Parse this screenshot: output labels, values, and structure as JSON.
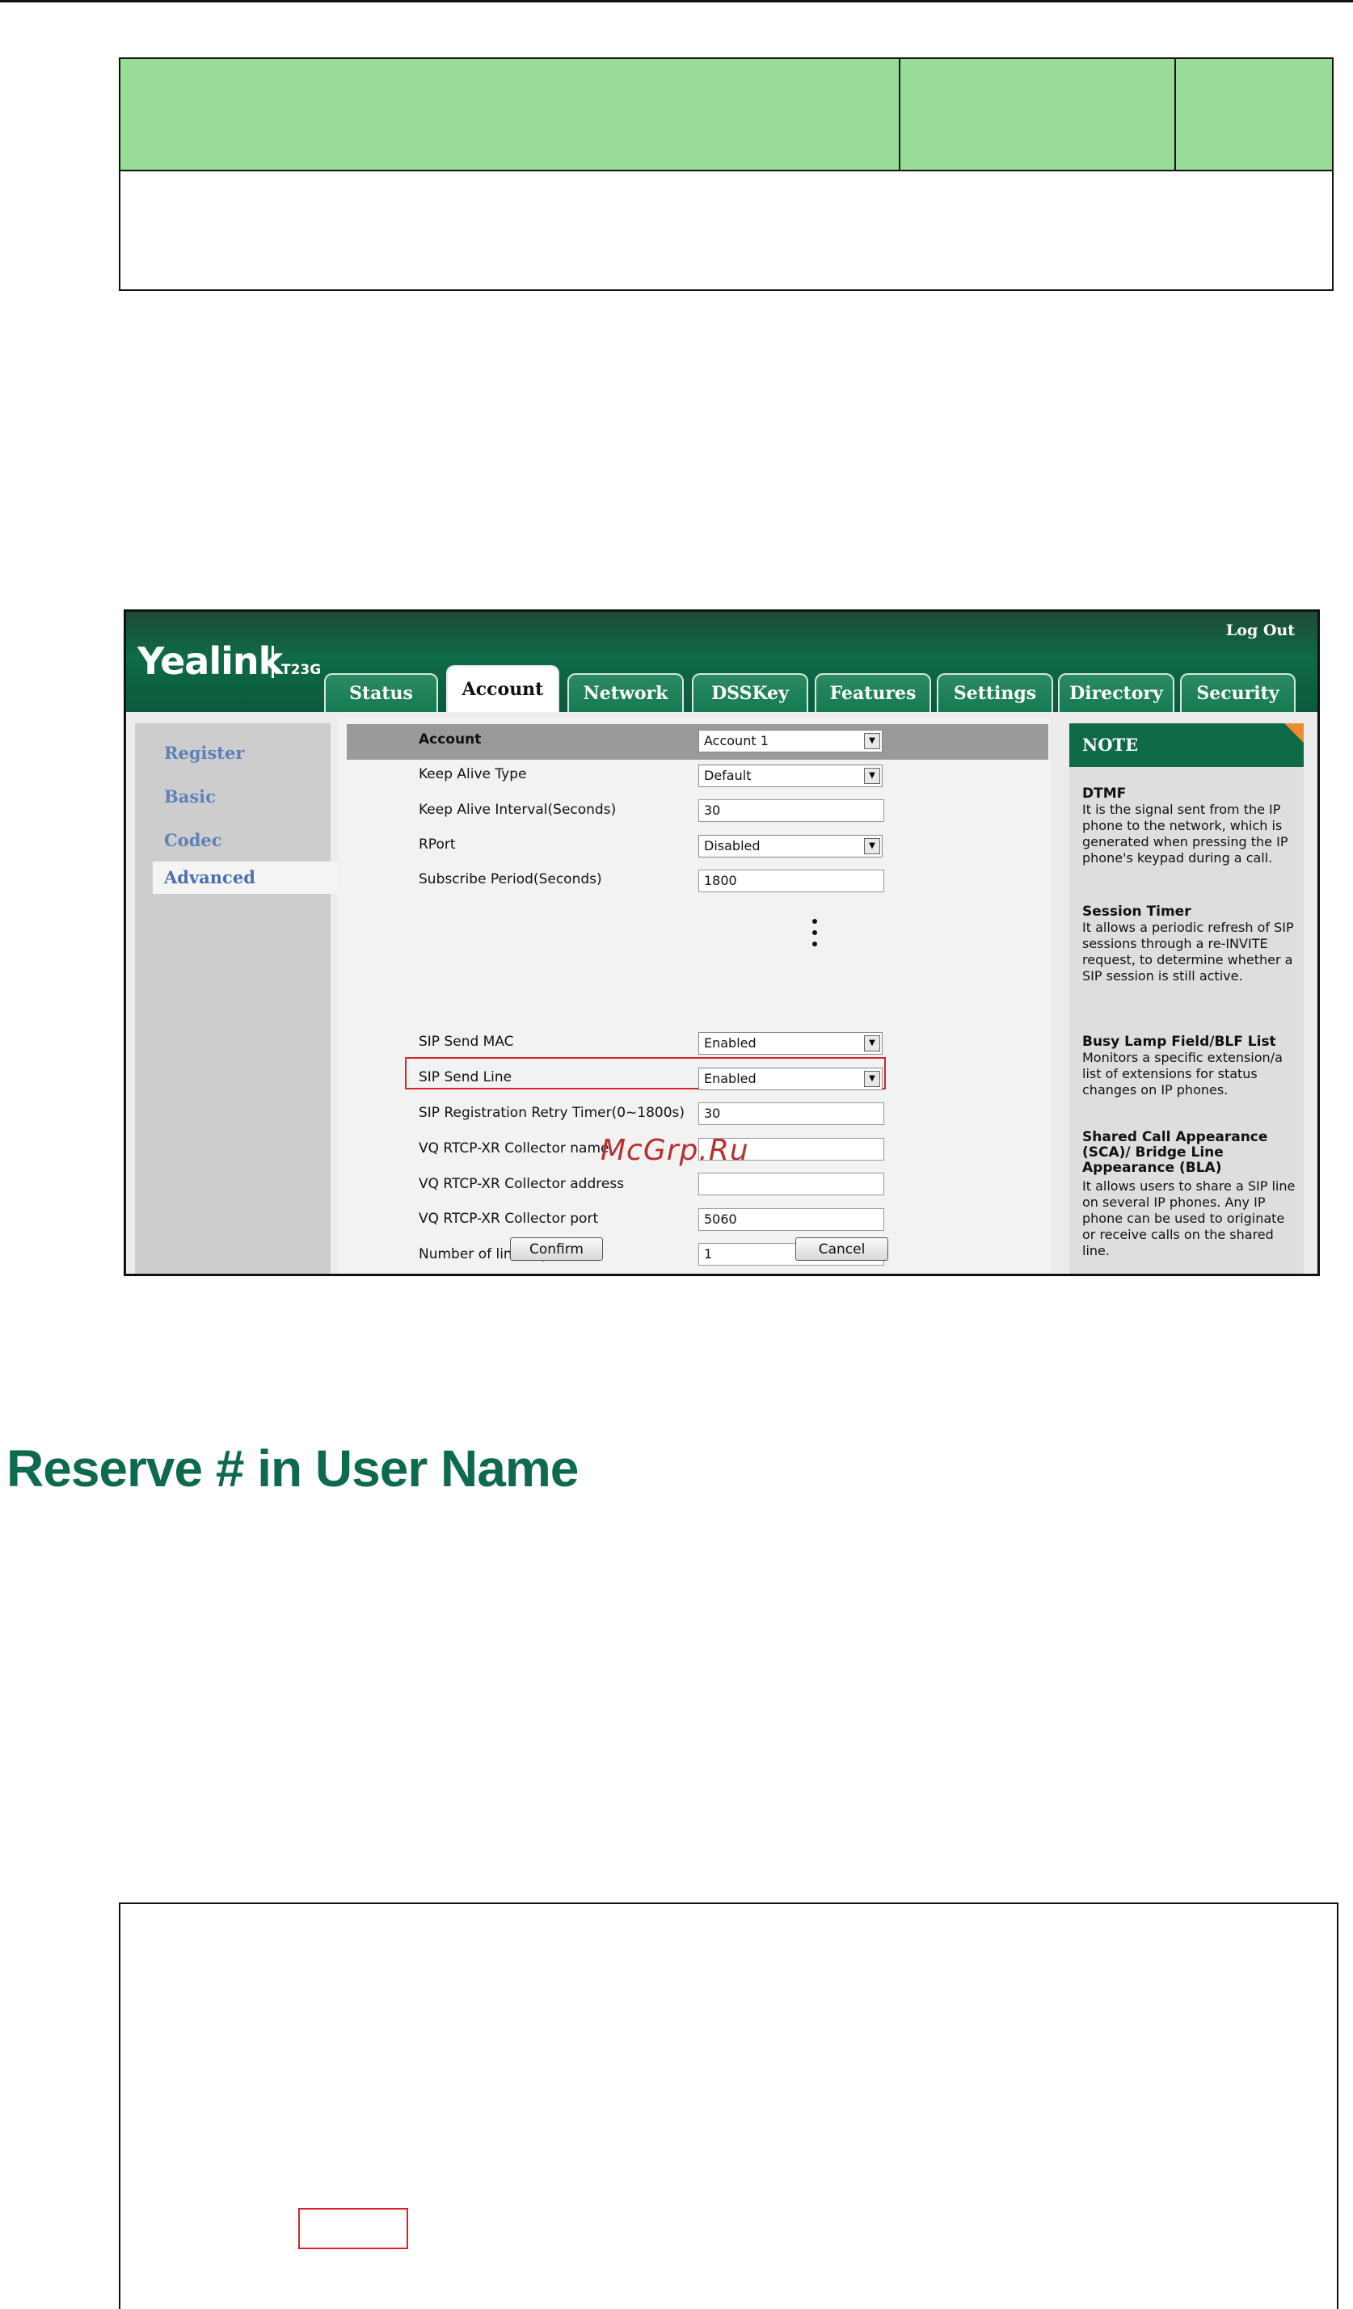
{
  "header": {
    "logo": "Yealink",
    "model": "T23G",
    "logout": "Log Out"
  },
  "tabs": [
    {
      "label": "Status"
    },
    {
      "label": "Account",
      "active": true
    },
    {
      "label": "Network"
    },
    {
      "label": "DSSKey"
    },
    {
      "label": "Features"
    },
    {
      "label": "Settings"
    },
    {
      "label": "Directory"
    },
    {
      "label": "Security"
    }
  ],
  "sidebar": {
    "items": [
      {
        "label": "Register"
      },
      {
        "label": "Basic"
      },
      {
        "label": "Codec"
      },
      {
        "label": "Advanced",
        "active": true
      }
    ]
  },
  "form": {
    "account": {
      "label": "Account",
      "value": "Account 1"
    },
    "keep_alive_type": {
      "label": "Keep Alive Type",
      "value": "Default"
    },
    "keep_alive_interval": {
      "label": "Keep Alive Interval(Seconds)",
      "value": "30"
    },
    "rport": {
      "label": "RPort",
      "value": "Disabled"
    },
    "subscribe_period": {
      "label": "Subscribe Period(Seconds)",
      "value": "1800"
    },
    "sip_send_mac": {
      "label": "SIP Send MAC",
      "value": "Enabled"
    },
    "sip_send_line": {
      "label": "SIP Send Line",
      "value": "Enabled"
    },
    "sip_retry_timer": {
      "label": "SIP Registration Retry Timer(0~1800s)",
      "value": "30"
    },
    "vq_collector_name": {
      "label": "VQ RTCP-XR Collector name",
      "value": ""
    },
    "vq_collector_address": {
      "label": "VQ RTCP-XR Collector address",
      "value": ""
    },
    "vq_collector_port": {
      "label": "VQ RTCP-XR Collector port",
      "value": "5060"
    },
    "number_of_line_key": {
      "label": "Number of line key",
      "value": "1"
    },
    "confirm": "Confirm",
    "cancel": "Cancel"
  },
  "note": {
    "title": "NOTE",
    "entries": [
      {
        "title": "DTMF",
        "text": "It is the signal sent from the IP phone to the network, which is generated when pressing the IP phone's keypad during a call."
      },
      {
        "title": "Session Timer",
        "text": "It allows a periodic refresh of SIP sessions through a re-INVITE request, to determine whether a SIP session is still active."
      },
      {
        "title": "Busy Lamp Field/BLF List",
        "text": "Monitors a specific extension/a list of extensions for status changes on IP phones."
      },
      {
        "title": "Shared Call Appearance (SCA)/ Bridge Line Appearance (BLA)",
        "text": "It allows users to share a SIP line on several IP phones. Any IP phone can be used to originate or receive calls on the shared line."
      }
    ]
  },
  "watermark": "McGrp.Ru",
  "section_heading": "Reserve # in User Name",
  "colors": {
    "header_green": "#0e6a47",
    "table_head_green": "#98dc98",
    "heading_green": "#0d6a4e",
    "highlight_red": "#d8232a"
  }
}
